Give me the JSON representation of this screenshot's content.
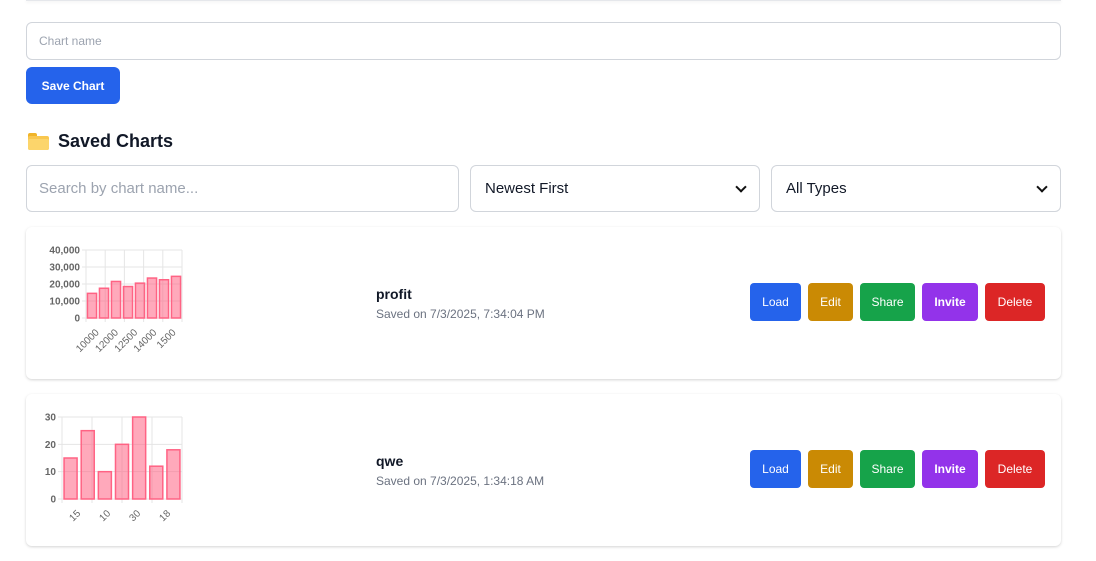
{
  "form": {
    "name_placeholder": "Chart name",
    "save_label": "Save Chart"
  },
  "saved": {
    "title": "Saved Charts",
    "icon": "folder-icon",
    "search_placeholder": "Search by chart name...",
    "sort_value": "Newest First",
    "type_value": "All Types"
  },
  "actions": {
    "load": "Load",
    "edit": "Edit",
    "share": "Share",
    "invite": "Invite",
    "delete": "Delete"
  },
  "colors": {
    "primary": "#2563eb",
    "edit": "#ca8a04",
    "share": "#16a34a",
    "invite": "#9333ea",
    "delete": "#dc2626",
    "bar": "#ff6384"
  },
  "charts": [
    {
      "name": "profit",
      "date": "Saved on 7/3/2025, 7:34:04 PM",
      "chart_data": {
        "type": "bar",
        "categories": [
          "10000",
          "",
          "12000",
          "",
          "12500",
          "",
          "14000",
          "",
          "1500"
        ],
        "values": [
          14500,
          17500,
          21500,
          18500,
          20500,
          23500,
          22500,
          24500
        ],
        "ylim": [
          0,
          40000
        ],
        "yticks": [
          "40,000",
          "30,000",
          "20,000",
          "10,000",
          "0"
        ],
        "xticks": [
          "10000",
          "12000",
          "12500",
          "14000",
          "1500"
        ]
      }
    },
    {
      "name": "qwe",
      "date": "Saved on 7/3/2025, 1:34:18 AM",
      "chart_data": {
        "type": "bar",
        "values": [
          15,
          25,
          10,
          20,
          30,
          12,
          18
        ],
        "ylim": [
          0,
          30
        ],
        "yticks": [
          "30",
          "20",
          "10",
          "0"
        ],
        "xticks": [
          "15",
          "10",
          "30",
          "18"
        ]
      }
    }
  ]
}
